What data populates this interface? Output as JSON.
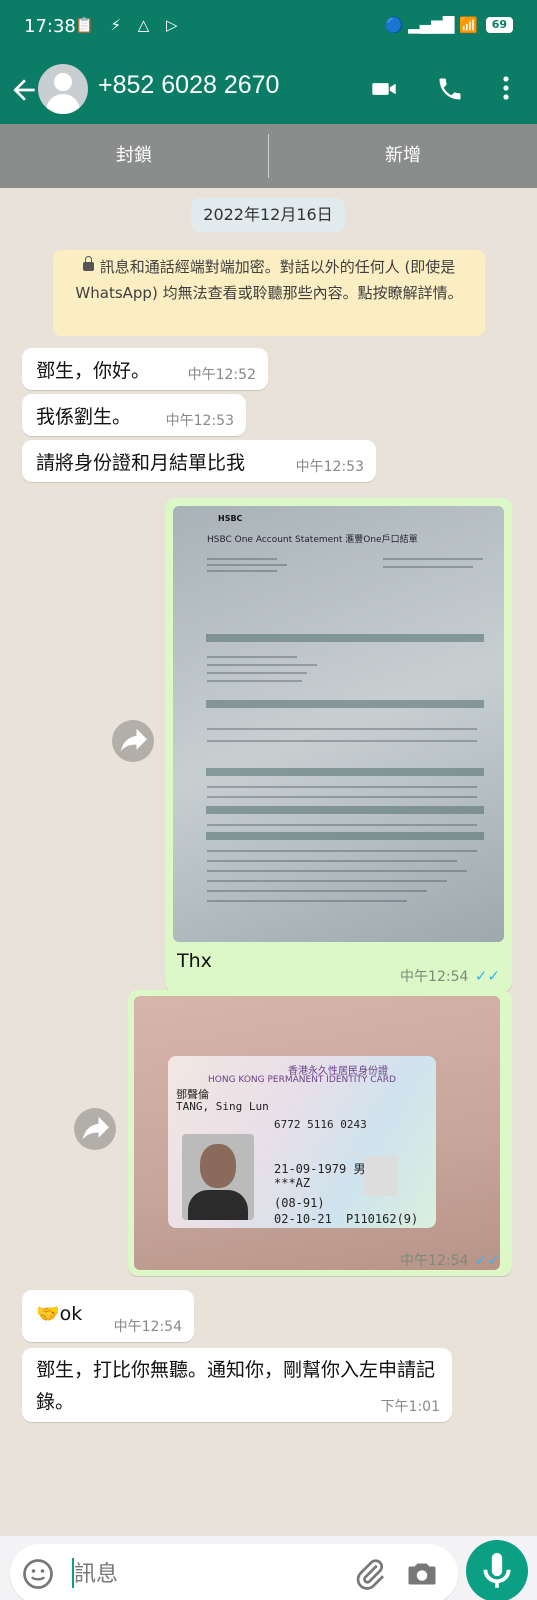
{
  "status_bar": {
    "time": "17:38",
    "left_icons": "📋 ⚡ △ ▷",
    "signal": "🔵 ▂▄▆█ 📶",
    "battery": "69"
  },
  "header": {
    "contact": "+852 6028 2670",
    "back_icon": "arrow-left",
    "video_icon": "video-camera",
    "call_icon": "phone",
    "menu_icon": "more-vertical"
  },
  "actions": {
    "block": "封鎖",
    "add": "新增"
  },
  "chat": {
    "date": "2022年12月16日",
    "encryption_notice": "訊息和通話經端對端加密。對話以外的任何人 (即使是 WhatsApp) 均無法查看或聆聽那些內容。點按瞭解詳情。",
    "messages": [
      {
        "dir": "in",
        "text": "鄧生，你好。",
        "time": "中午12:52"
      },
      {
        "dir": "in",
        "text": "我係劉生。",
        "time": "中午12:53"
      },
      {
        "dir": "in",
        "text": "請將身份證和月結單比我",
        "time": "中午12:53"
      },
      {
        "dir": "out",
        "type": "image",
        "caption": "Thx",
        "time": "中午12:54",
        "status": "✓✓"
      },
      {
        "dir": "out",
        "type": "image",
        "caption": "",
        "time": "中午12:54",
        "status": "✓✓"
      },
      {
        "dir": "in",
        "text": "🤝ok",
        "time": "中午12:54"
      },
      {
        "dir": "in",
        "text": "鄧生，打比你無聽。通知你，剛幫你入左申請記錄。",
        "time": "下午1:01"
      }
    ],
    "statement_image": {
      "title": "HSBC One Account Statement 滙豐One戶口結單",
      "logo": "HSBC"
    },
    "id_image": {
      "title_cn": "香港永久性居民身份證",
      "title_en": "HONG KONG PERMANENT IDENTITY CARD",
      "name_cn": "鄧聲倫",
      "name_en": "TANG, Sing Lun",
      "number": "6772 5116 0243",
      "dob": "21-09-1979 男 M",
      "code": "***AZ",
      "issue": "(08-91)",
      "issue_date": "02-10-21",
      "hkid": "P110162(9)"
    }
  },
  "composer": {
    "placeholder": "訊息"
  }
}
